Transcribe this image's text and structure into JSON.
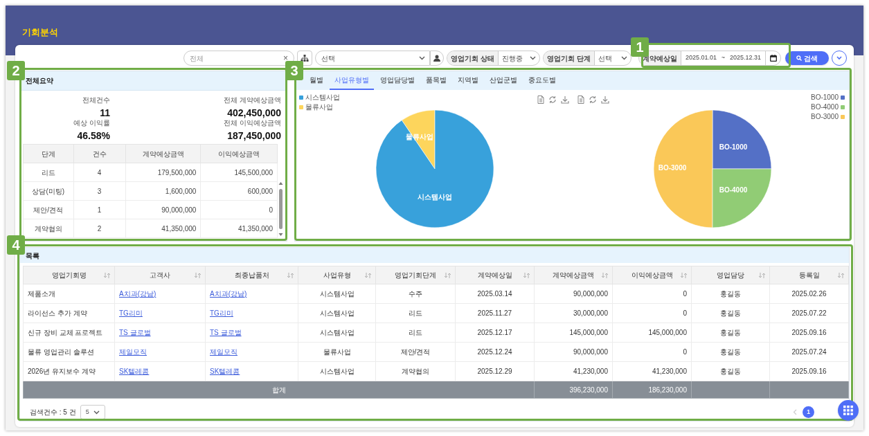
{
  "page": {
    "title": "기회분석"
  },
  "filters": {
    "keyword": {
      "placeholder": "전체",
      "clear": "×"
    },
    "org": {
      "value": "선택"
    },
    "status": {
      "label": "영업기회 상태",
      "value": "진행중"
    },
    "stage": {
      "label": "영업기회 단계",
      "value": "선택"
    },
    "date_range": {
      "label": "계약예상일",
      "from": "2025.01.01",
      "separator": "~",
      "to": "2025.12.31"
    },
    "search_button": "검색"
  },
  "summary": {
    "title": "전체요약",
    "stats": [
      {
        "label": "전체건수",
        "value": "11"
      },
      {
        "label": "전체 계약예상금액",
        "value": "402,450,000"
      },
      {
        "label": "예상 이익률",
        "value": "46.58%"
      },
      {
        "label": "전체 이익예상금액",
        "value": "187,450,000"
      }
    ],
    "table": {
      "columns": [
        "단계",
        "건수",
        "계약예상금액",
        "이익예상금액"
      ],
      "rows": [
        [
          "리드",
          "4",
          "179,500,000",
          "145,500,000"
        ],
        [
          "상담(미팅)",
          "3",
          "1,600,000",
          "600,000"
        ],
        [
          "제안/견적",
          "1",
          "90,000,000",
          "0"
        ],
        [
          "계약협의",
          "2",
          "41,350,000",
          "41,350,000"
        ]
      ]
    }
  },
  "charts": {
    "tabs": [
      {
        "label": "월별",
        "selected": false
      },
      {
        "label": "사업유형별",
        "selected": true
      },
      {
        "label": "영업담당별",
        "selected": false
      },
      {
        "label": "품목별",
        "selected": false
      },
      {
        "label": "지역별",
        "selected": false
      },
      {
        "label": "산업군별",
        "selected": false
      },
      {
        "label": "중요도별",
        "selected": false
      }
    ],
    "pies": [
      {
        "legend": [
          {
            "label": "시스템사업",
            "color": "#38a1db"
          },
          {
            "label": "물류사업",
            "color": "#fdd55c"
          }
        ],
        "slices": [
          {
            "label": "물류사업",
            "color": "#fdd55c"
          },
          {
            "label": "시스템사업",
            "color": "#38a1db"
          }
        ]
      },
      {
        "legend": [
          {
            "label": "BO-1000",
            "color": "#5470c6"
          },
          {
            "label": "BO-4000",
            "color": "#91cc75"
          },
          {
            "label": "BO-3000",
            "color": "#fac858"
          }
        ],
        "slices": [
          {
            "label": "BO-1000",
            "color": "#5470c6"
          },
          {
            "label": "BO-3000",
            "color": "#fac858"
          },
          {
            "label": "BO-4000",
            "color": "#91cc75"
          }
        ]
      }
    ]
  },
  "list": {
    "title": "목록",
    "columns": [
      {
        "label": "영업기회명",
        "kind": "text"
      },
      {
        "label": "고객사",
        "kind": "link"
      },
      {
        "label": "최종납품처",
        "kind": "link"
      },
      {
        "label": "사업유형",
        "kind": "center"
      },
      {
        "label": "영업기회단계",
        "kind": "center"
      },
      {
        "label": "계약예상일",
        "kind": "center"
      },
      {
        "label": "계약예상금액",
        "kind": "number"
      },
      {
        "label": "이익예상금액",
        "kind": "number"
      },
      {
        "label": "영업담당",
        "kind": "center"
      },
      {
        "label": "등록일",
        "kind": "center"
      }
    ],
    "rows": [
      [
        "제품소개",
        "A치과(강남)",
        "A치과(강남)",
        "시스템사업",
        "수주",
        "2025.03.14",
        "90,000,000",
        "0",
        "홍길동",
        "2025.02.26"
      ],
      [
        "라이선스 추가 계약",
        "TG리미",
        "TG리미",
        "시스템사업",
        "리드",
        "2025.11.27",
        "30,000,000",
        "0",
        "홍길동",
        "2025.07.22"
      ],
      [
        "신규 장비 교체 프로젝트",
        "TS 글로벌",
        "TS 글로벌",
        "시스템사업",
        "리드",
        "2025.12.17",
        "145,000,000",
        "145,000,000",
        "홍길동",
        "2025.09.16"
      ],
      [
        "물류 영업관리 솔루션",
        "제일모직",
        "제일모직",
        "물류사업",
        "제안/견적",
        "2025.12.24",
        "90,000,000",
        "0",
        "홍길동",
        "2025.07.24"
      ],
      [
        "2026년 유지보수 계약",
        "SK텔레콤",
        "SK텔레콤",
        "시스템사업",
        "계약협의",
        "2025.12.29",
        "41,230,000",
        "41,230,000",
        "홍길동",
        "2025.09.16"
      ]
    ],
    "total": {
      "label": "합계",
      "contract_amount": "396,230,000",
      "profit_amount": "186,230,000"
    },
    "footer": {
      "count": "검색건수 : 5 건",
      "page_size": "5",
      "pages": [
        {
          "label": "1",
          "selected": true
        }
      ]
    }
  },
  "annotations": [
    {
      "number": "1"
    },
    {
      "number": "2"
    },
    {
      "number": "3"
    },
    {
      "number": "4"
    }
  ]
}
